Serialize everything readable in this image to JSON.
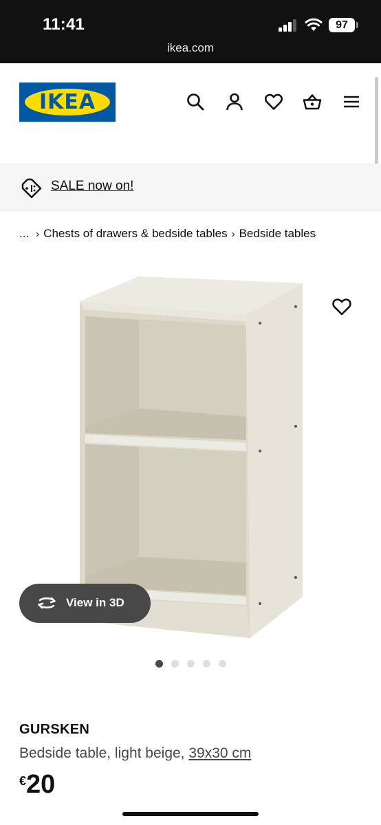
{
  "status_bar": {
    "time": "11:41",
    "url": "ikea.com",
    "battery": "97"
  },
  "header": {
    "logo_text": "IKEA",
    "brand_blue": "#0058a3",
    "brand_yellow": "#ffdb00",
    "icons": [
      "search-icon",
      "profile-icon",
      "heart-icon",
      "basket-icon",
      "menu-icon"
    ]
  },
  "sale_banner": {
    "link_text": "SALE now on!",
    "icon": "price-tag-icon"
  },
  "breadcrumb": {
    "ellipsis": "...",
    "separator": "›",
    "items": [
      "Chests of drawers & bedside tables",
      "Bedside tables"
    ]
  },
  "gallery": {
    "view3d_label": "View in 3D",
    "image_count": 5,
    "active_index": 0
  },
  "product": {
    "name": "GURSKEN",
    "description": "Bedside table, light beige, ",
    "size": "39x30 cm",
    "currency": "€",
    "price": "20"
  }
}
